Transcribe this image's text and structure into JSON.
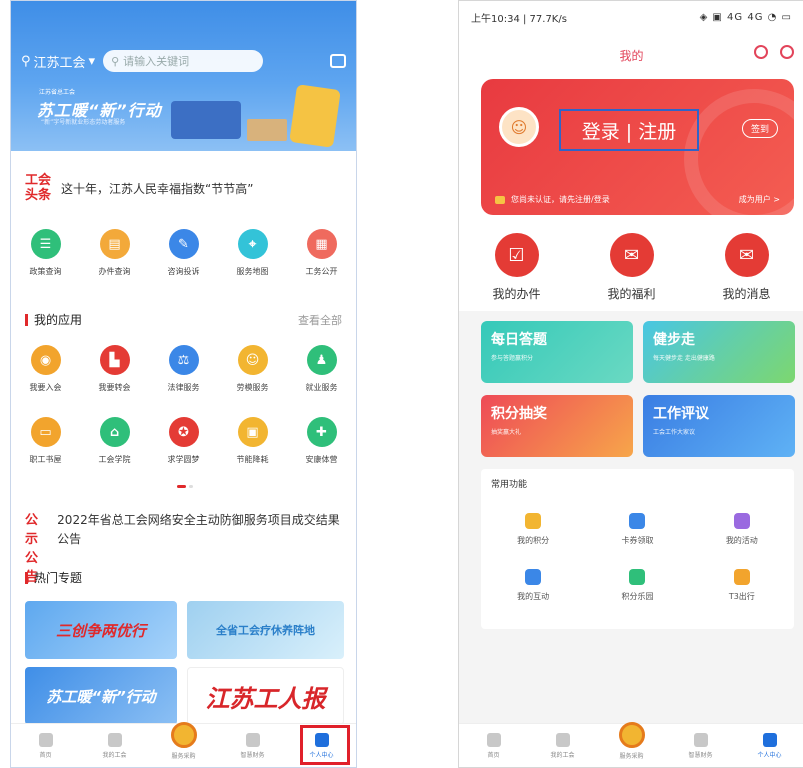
{
  "left": {
    "location": "江苏工会",
    "search_placeholder": "请输入关键词",
    "banner": {
      "logo_text": "江苏省总工会",
      "title": "苏工暖“新”行动",
      "subtitle": "“新”字号新就业形态劳动者服务"
    },
    "news": {
      "tag": "工会头条",
      "text": "这十年，江苏人民幸福指数“节节高”"
    },
    "services": [
      {
        "label": "政策查询",
        "icon": "policy-icon",
        "color": "#2fbf7a",
        "glyph": "☰"
      },
      {
        "label": "办件查询",
        "icon": "case-icon",
        "color": "#f3a93a",
        "glyph": "▤"
      },
      {
        "label": "咨询投诉",
        "icon": "consult-icon",
        "color": "#3b87e7",
        "glyph": "✎"
      },
      {
        "label": "服务地图",
        "icon": "map-icon",
        "color": "#33c3d8",
        "glyph": "⌖"
      },
      {
        "label": "工务公开",
        "icon": "open-icon",
        "color": "#ef6a5e",
        "glyph": "▦"
      }
    ],
    "my_apps": {
      "title": "我的应用",
      "more": "查看全部"
    },
    "apps_row1": [
      {
        "label": "我要入会",
        "icon": "join-union-icon",
        "color": "#f2a42d",
        "glyph": "◉"
      },
      {
        "label": "我要转会",
        "icon": "transfer-icon",
        "color": "#e43b35",
        "glyph": "▙"
      },
      {
        "label": "法律服务",
        "icon": "legal-icon",
        "color": "#3b87e7",
        "glyph": "⚖"
      },
      {
        "label": "劳模服务",
        "icon": "model-worker-icon",
        "color": "#f2b531",
        "glyph": "☺"
      },
      {
        "label": "就业服务",
        "icon": "employment-icon",
        "color": "#2fbf7a",
        "glyph": "♟"
      }
    ],
    "apps_row2": [
      {
        "label": "职工书屋",
        "icon": "library-icon",
        "color": "#f2a42d",
        "glyph": "▭"
      },
      {
        "label": "工会学院",
        "icon": "academy-icon",
        "color": "#2fbf7a",
        "glyph": "⌂"
      },
      {
        "label": "求学圆梦",
        "icon": "study-icon",
        "color": "#e43b35",
        "glyph": "✪"
      },
      {
        "label": "节能降耗",
        "icon": "energy-icon",
        "color": "#f2b531",
        "glyph": "▣"
      },
      {
        "label": "安康体营",
        "icon": "health-icon",
        "color": "#2fbf7a",
        "glyph": "✚"
      }
    ],
    "notice": {
      "tag1": "公示",
      "tag2": "公告",
      "text": "2022年省总工会网络安全主动防御服务项目成交结果公告"
    },
    "topics_title": "热门专题",
    "topics": [
      "三创争两优行",
      "全省工会疗休养阵地",
      "苏工暖“新”行动",
      "江苏工人报"
    ],
    "tabs": [
      "首页",
      "我的工会",
      "服务采购",
      "智慧财务",
      "个人中心"
    ]
  },
  "right": {
    "status_time": "上午10:34 | 77.7K/s",
    "status_icons": "◈ ▣ 4G 4G ◔ ▭",
    "nav_title": "我的",
    "login": "登录 | 注册",
    "sign_in": "签到",
    "strip_left": "您尚未认证，请先注册/登录",
    "strip_right": "成为用户 >",
    "quick": [
      {
        "label": "我的办件",
        "icon": "my-case-icon",
        "glyph": "☑"
      },
      {
        "label": "我的福利",
        "icon": "gift-icon",
        "glyph": "✉"
      },
      {
        "label": "我的消息",
        "icon": "message-icon",
        "glyph": "✉"
      }
    ],
    "promos": [
      {
        "title": "每日答题",
        "sub": "参与答题赢积分"
      },
      {
        "title": "健步走",
        "sub": "每天健步走 走出健康路"
      },
      {
        "title": "积分抽奖",
        "sub": "抽奖赢大礼"
      },
      {
        "title": "工作评议",
        "sub": "工会工作大家议"
      }
    ],
    "common_title": "常用功能",
    "common_row1": [
      {
        "label": "我的积分",
        "icon": "points-icon",
        "color": "#f2b531"
      },
      {
        "label": "卡券领取",
        "icon": "coupon-icon",
        "color": "#3b87e7"
      },
      {
        "label": "我的活动",
        "icon": "activity-icon",
        "color": "#9a6ae0"
      }
    ],
    "common_row2": [
      {
        "label": "我的互动",
        "icon": "interaction-icon",
        "color": "#3b87e7"
      },
      {
        "label": "积分乐园",
        "icon": "park-icon",
        "color": "#2fbf7a"
      },
      {
        "label": "T3出行",
        "icon": "travel-icon",
        "color": "#f2a42d"
      }
    ],
    "tabs": [
      "首页",
      "我的工会",
      "服务采购",
      "智慧财务",
      "个人中心"
    ]
  }
}
